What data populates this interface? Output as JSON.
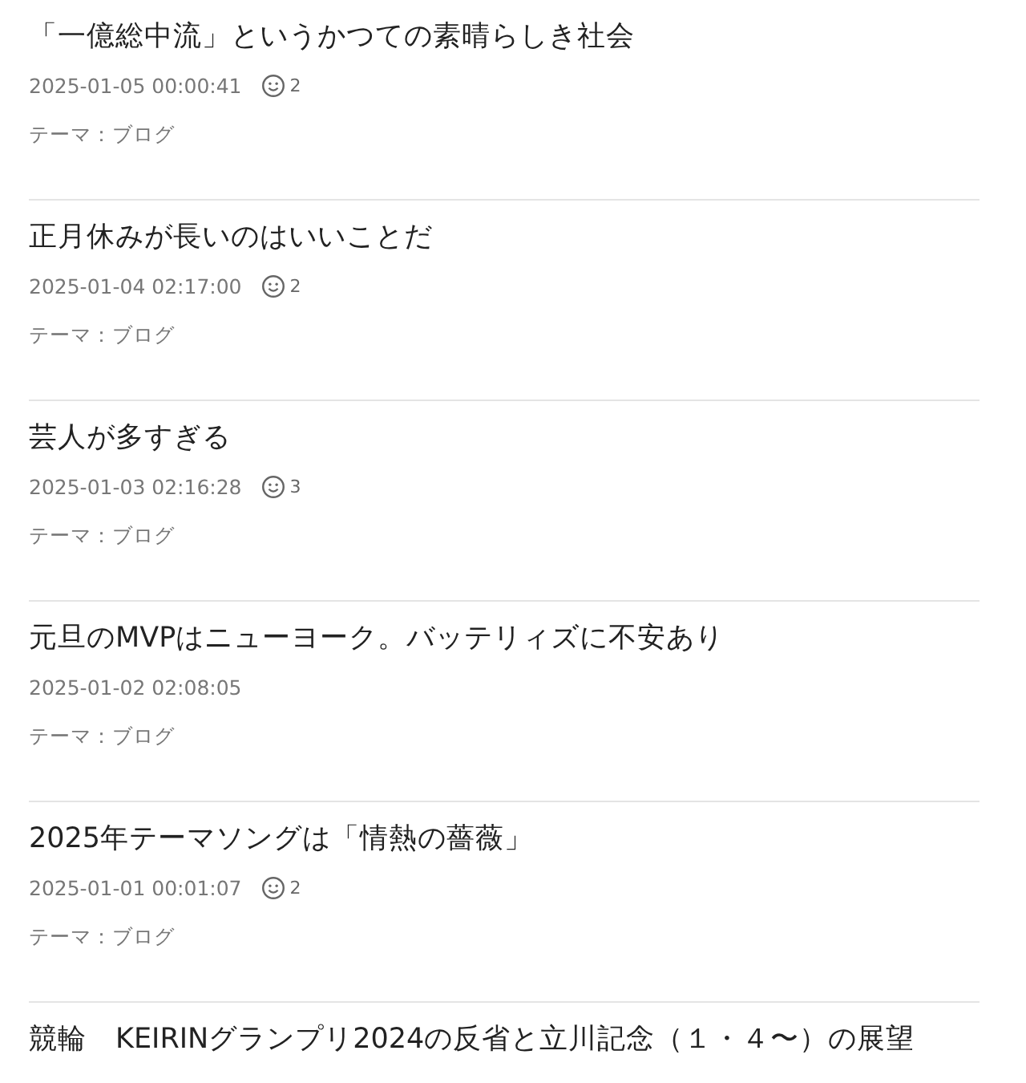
{
  "posts": [
    {
      "title": "「一億総中流」というかつての素晴らしき社会",
      "date": "2025-01-05 00:00:41",
      "comments": "2",
      "theme": "テーマ：ブログ"
    },
    {
      "title": "正月休みが長いのはいいことだ",
      "date": "2025-01-04 02:17:00",
      "comments": "2",
      "theme": "テーマ：ブログ"
    },
    {
      "title": "芸人が多すぎる",
      "date": "2025-01-03 02:16:28",
      "comments": "3",
      "theme": "テーマ：ブログ"
    },
    {
      "title": "元旦のMVPはニューヨーク。バッテリィズに不安あり",
      "date": "2025-01-02 02:08:05",
      "theme": "テーマ：ブログ"
    },
    {
      "title": "2025年テーマソングは「情熱の薔薇」",
      "date": "2025-01-01 00:01:07",
      "comments": "2",
      "theme": "テーマ：ブログ"
    },
    {
      "title": "競輪　KEIRINグランプリ2024の反省と立川記念（１・４〜）の展望"
    }
  ]
}
